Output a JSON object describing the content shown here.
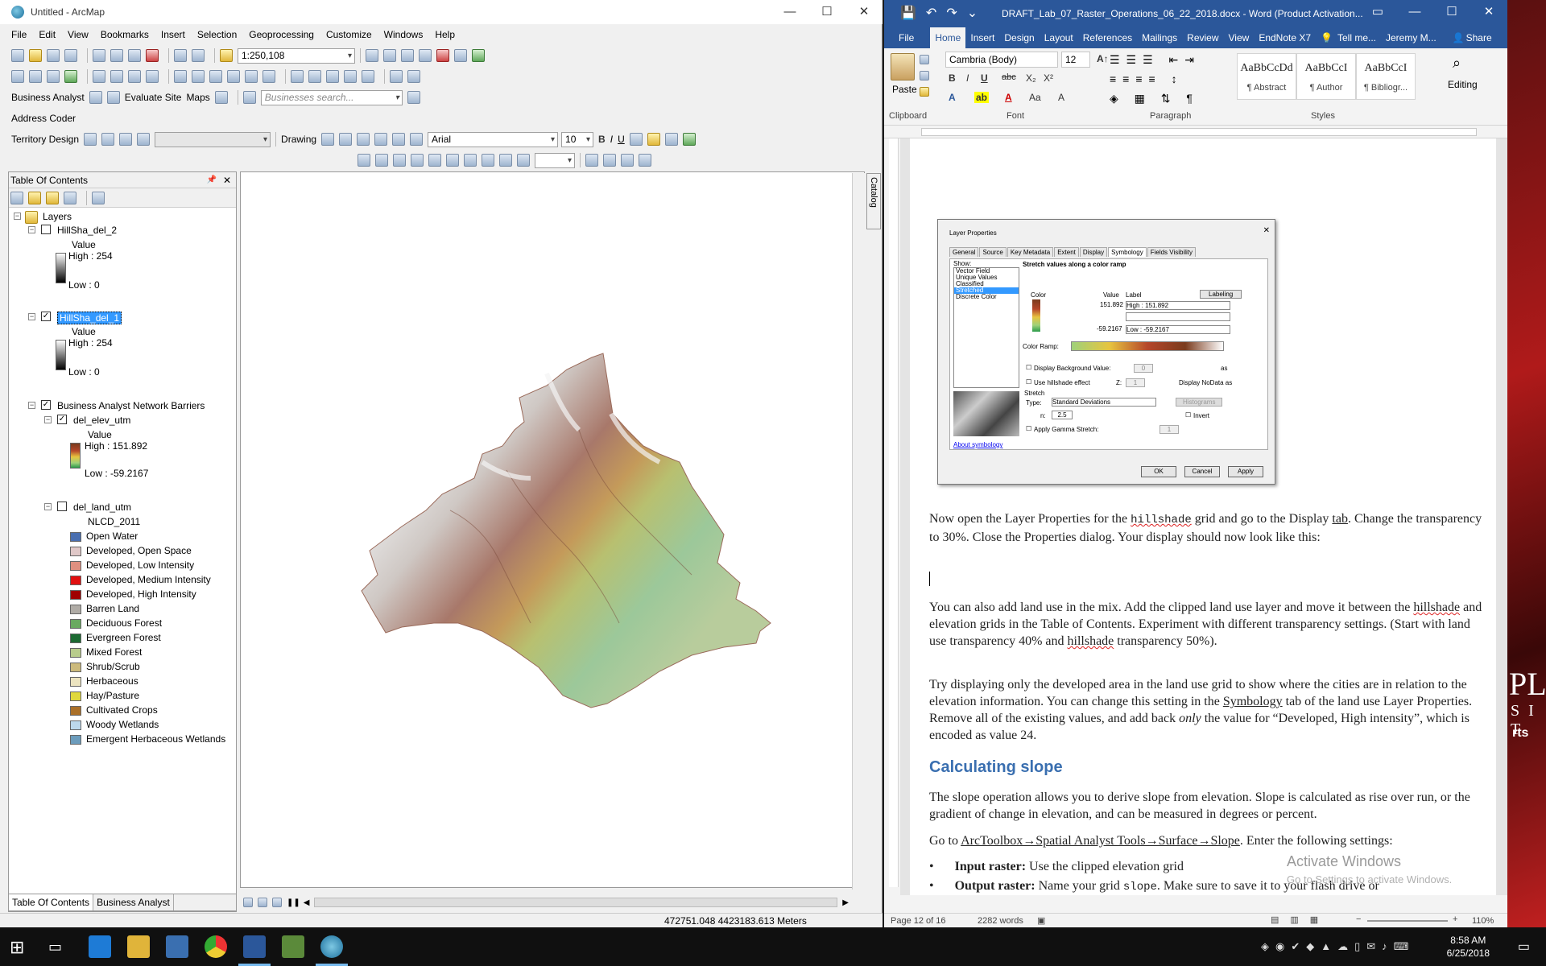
{
  "arcmap": {
    "title": "Untitled - ArcMap",
    "menu": [
      "File",
      "Edit",
      "View",
      "Bookmarks",
      "Insert",
      "Selection",
      "Geoprocessing",
      "Customize",
      "Windows",
      "Help"
    ],
    "scale": "1:250,108",
    "business_analyst": "Business Analyst",
    "evaluate_site": "Evaluate Site",
    "maps": "Maps",
    "search_placeholder": "Businesses search...",
    "address_coder": "Address Coder",
    "territory_design": "Territory Design",
    "drawing": "Drawing",
    "font": "Arial",
    "font_size": "10",
    "toc": {
      "title": "Table Of Contents",
      "layers_root": "Layers",
      "hill2": {
        "name": "HillSha_del_2",
        "value": "Value",
        "high": "High : 254",
        "low": "Low : 0"
      },
      "hill1": {
        "name": "HillSha_del_1",
        "value": "Value",
        "high": "High : 254",
        "low": "Low : 0"
      },
      "network": "Business Analyst Network Barriers",
      "elev": {
        "name": "del_elev_utm",
        "value": "Value",
        "high": "High : 151.892",
        "low": "Low : -59.2167"
      },
      "land": {
        "name": "del_land_utm",
        "field": "NLCD_2011"
      },
      "classes": [
        {
          "label": "Open Water",
          "color": "#4a6fb0"
        },
        {
          "label": "Developed, Open Space",
          "color": "#e0c8c8"
        },
        {
          "label": "Developed, Low Intensity",
          "color": "#e09080"
        },
        {
          "label": "Developed, Medium Intensity",
          "color": "#e01010"
        },
        {
          "label": "Developed, High Intensity",
          "color": "#a00000"
        },
        {
          "label": "Barren Land",
          "color": "#b0aca6"
        },
        {
          "label": "Deciduous Forest",
          "color": "#6aaa60"
        },
        {
          "label": "Evergreen Forest",
          "color": "#1c6a32"
        },
        {
          "label": "Mixed Forest",
          "color": "#b8cc8c"
        },
        {
          "label": "Shrub/Scrub",
          "color": "#ccba7c"
        },
        {
          "label": "Herbaceous",
          "color": "#ece4c0"
        },
        {
          "label": "Hay/Pasture",
          "color": "#e0d83c"
        },
        {
          "label": "Cultivated Crops",
          "color": "#aa7028"
        },
        {
          "label": "Woody Wetlands",
          "color": "#bcd8ec"
        },
        {
          "label": "Emergent Herbaceous Wetlands",
          "color": "#6c9cbc"
        }
      ],
      "tab_toc": "Table Of Contents",
      "tab_ba": "Business Analyst"
    },
    "catalog": "Catalog",
    "coords": "472751.048  4423183.613 Meters"
  },
  "word": {
    "title": "DRAFT_Lab_07_Raster_Operations_06_22_2018.docx - Word (Product Activation...",
    "tabs": [
      "File",
      "Home",
      "Insert",
      "Design",
      "Layout",
      "References",
      "Mailings",
      "Review",
      "View",
      "EndNote X7"
    ],
    "tell_me": "Tell me...",
    "user": "Jeremy M...",
    "share": "Share",
    "font": "Cambria (Body)",
    "font_size": "12",
    "paste": "Paste",
    "editing": "Editing",
    "groups": {
      "clipboard": "Clipboard",
      "font": "Font",
      "paragraph": "Paragraph",
      "styles": "Styles"
    },
    "styles": [
      {
        "preview": "AaBbCcDd",
        "name": "¶ Abstract"
      },
      {
        "preview": "AaBbCcI",
        "name": "¶ Author"
      },
      {
        "preview": "AaBbCcI",
        "name": "¶ Bibliogr..."
      }
    ],
    "dialog": {
      "title": "Layer Properties",
      "tabs": [
        "General",
        "Source",
        "Key Metadata",
        "Extent",
        "Display",
        "Symbology",
        "Fields Visibility"
      ],
      "show_label": "Show:",
      "show_items": [
        "Vector Field",
        "Unique Values",
        "Classified",
        "Stretched",
        "Discrete Color"
      ],
      "heading": "Stretch values along a color ramp",
      "color": "Color",
      "value": "Value",
      "label": "Label",
      "labeling": "Labeling",
      "high_val": "151.892",
      "high_label": "High : 151.892",
      "low_val": "-59.2167",
      "low_label": "Low : -59.2167",
      "color_ramp": "Color Ramp:",
      "bg": "Display Background Value:",
      "bg_val": "0",
      "bg_as": "as",
      "hillshade": "Use hillshade effect",
      "hillshade_z": "Z:",
      "hillshade_val": "1",
      "nodata": "Display NoData as",
      "stretch": "Stretch",
      "type": "Type:",
      "type_val": "Standard Deviations",
      "histograms": "Histograms",
      "n": "n:",
      "n_val": "2.5",
      "invert": "Invert",
      "gamma": "Apply Gamma Stretch:",
      "gamma_val": "1",
      "about": "About symbology",
      "ok": "OK",
      "cancel": "Cancel",
      "apply": "Apply"
    },
    "p1_a": "Now open the Layer Properties for the ",
    "p1_code": "hillshade",
    "p1_b": " grid and go to the Display ",
    "p1_tab": "tab",
    "p1_c": ". Change the transparency to 30%. Close the Properties dialog. Your display should now look like this:",
    "p2_a": "You can also add land use in the mix. Add the clipped land use layer and move it between the ",
    "p2_hs": "hillshade",
    "p2_b": " and elevation grids in the Table of Contents. Experiment with different transparency settings. (Start with land use transparency 40% and ",
    "p2_hs2": "hillshade",
    "p2_c": " transparency 50%).",
    "p3_a": "Try displaying only the developed area in the land use grid to show where the cities are in relation to the elevation information. You can change this setting in the ",
    "p3_sym": "Symbology",
    "p3_b": " tab of the land use Layer Properties. Remove all of the existing values, and add back ",
    "p3_only": "only",
    "p3_c": " the value for “Developed, High intensity”, which is encoded as value 24.",
    "heading": "Calculating slope",
    "p4": "The slope operation allows you to derive slope from elevation. Slope is calculated as rise over run, or the gradient of change in elevation, and can be measured in degrees or percent.",
    "p5_a": "Go to ",
    "p5_path": "ArcToolbox→Spatial Analyst Tools→Surface→Slope",
    "p5_b": ". Enter the following settings:",
    "b1_label": "Input raster:",
    "b1_text": " Use the clipped elevation grid",
    "b2_label": "Output raster:",
    "b2_a": " Name your grid ",
    "b2_code": "slope",
    "b2_b": ". Make sure to save it to your flash drive or",
    "activate": "Activate Windows",
    "activate2": "Go to Settings to activate Windows.",
    "page": "Page 12 of 16",
    "words": "2282 words",
    "zoom": "110%"
  },
  "taskbar": {
    "time": "8:58 AM",
    "date": "6/25/2018"
  },
  "desktop": {
    "a": "PL",
    "b": "S I T",
    "c": "rts"
  }
}
